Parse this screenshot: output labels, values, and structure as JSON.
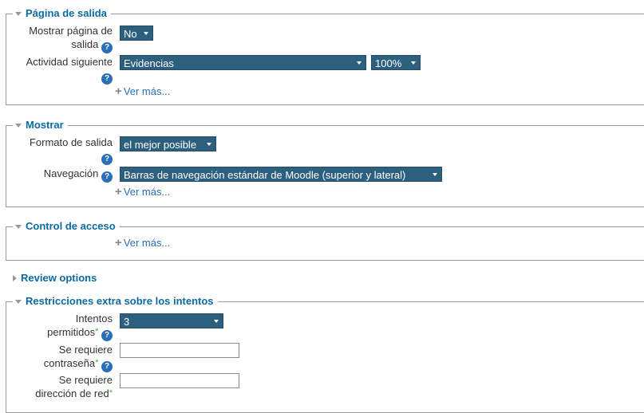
{
  "sections": {
    "salida": {
      "title": "Página de salida",
      "mostrar_label_1": "Mostrar página de",
      "mostrar_label_2": "salida",
      "mostrar_value": "No",
      "actividad_label": "Actividad siguiente",
      "actividad_value": "Evidencias",
      "percent_value": "100%",
      "more": "Ver más..."
    },
    "mostrar": {
      "title": "Mostrar",
      "formato_label": "Formato de salida",
      "formato_value": "el mejor posible",
      "navegacion_label": "Navegación",
      "navegacion_value": "Barras de navegación estándar de Moodle (superior y lateral)",
      "more": "Ver más..."
    },
    "acceso": {
      "title": "Control de acceso",
      "more": "Ver más..."
    },
    "review": {
      "title": "Review options"
    },
    "restricciones": {
      "title": "Restricciones extra sobre los intentos",
      "intentos_label_1": "Intentos",
      "intentos_label_2": "permitidos",
      "intentos_value": "3",
      "contrasena_label_1": "Se requiere",
      "contrasena_label_2": "contraseña",
      "red_label_1": "Se requiere",
      "red_label_2": "dirección de red"
    }
  },
  "help_glyph": "?",
  "required_glyph": "*",
  "plus_glyph": "+",
  "colors": {
    "legend": "#0a6aa1",
    "select_bg": "#2d5f7f",
    "help_bg": "#2a6fb7",
    "link": "#2a6fb7",
    "required": "#3cb43c"
  }
}
